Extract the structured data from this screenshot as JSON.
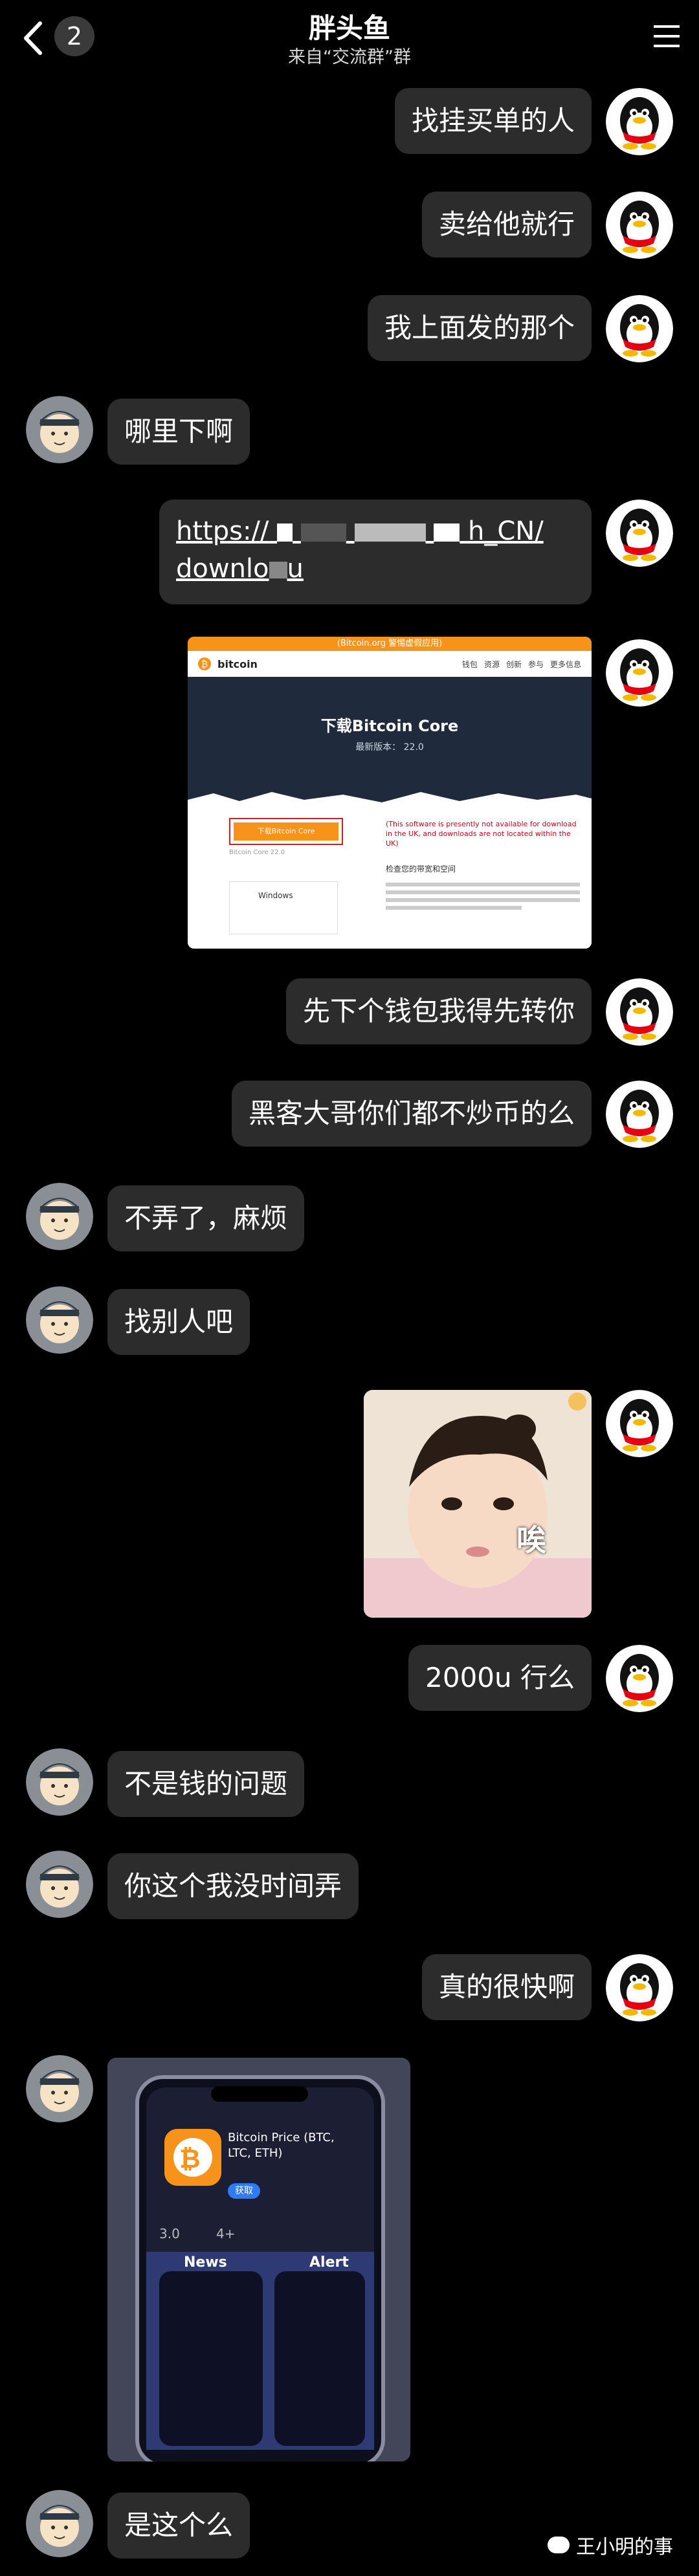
{
  "header": {
    "back_count": "2",
    "title": "胖头鱼",
    "subtitle": "来自“交流群”群"
  },
  "messages": {
    "m1": "找挂买单的人",
    "m2": "卖给他就行",
    "m3": "我上面发的那个",
    "m4": "哪里下啊",
    "m5_link_a": "https://",
    "m5_link_b": "h_CN/",
    "m5_link_c": "downlo",
    "m5_link_d": "u",
    "m7": "先下个钱包我得先转你",
    "m8": "黑客大哥你们都不炒币的么",
    "m9": "不弄了，麻烦",
    "m10": "找别人吧",
    "m12": "2000u 行么",
    "m13": "不是钱的问题",
    "m14": "你这个我没时间弄",
    "m15": "真的很快啊",
    "m17": "是这个么"
  },
  "bitcoin_card": {
    "banner": "(Bitcoin.org 警惕虚假应用)",
    "logo": "bitcoin",
    "nav": [
      "钱包",
      "资源",
      "创新",
      "参与",
      "更多信息"
    ],
    "heading": "下载Bitcoin Core",
    "version": "最新版本： 22.0",
    "button": "下载Bitcoin Core",
    "notice": "(This software is presently not available for download in the UK, and downloads are not located within the UK)",
    "section": "检查您的带宽和空间",
    "os_label": "Windows",
    "small_label": "Bitcoin Core 22.0"
  },
  "baby_image": {
    "caption": "唉"
  },
  "phone_photo": {
    "app_name": "Bitcoin Price (BTC, LTC, ETH)",
    "get_button": "获取",
    "rating": "3.0",
    "age": "4+",
    "news": "News",
    "alert": "Alert"
  },
  "watermark": "王小明的事",
  "colors": {
    "bubble": "#2c2c2c",
    "bitcoin_orange": "#f7931a",
    "background": "#000000"
  }
}
